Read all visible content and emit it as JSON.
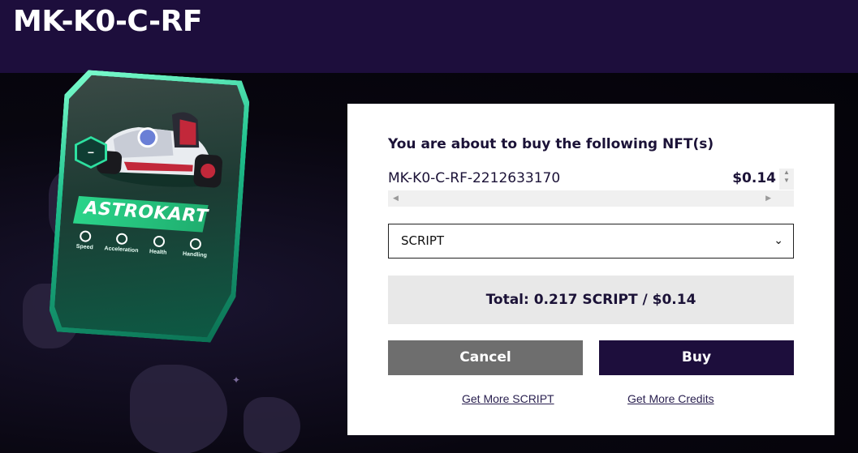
{
  "page": {
    "title": "MK-K0-C-RF"
  },
  "card": {
    "name": "ASTROKART",
    "badge": "−",
    "stats": [
      "Speed",
      "Acceleration",
      "Health",
      "Handling"
    ]
  },
  "purchase": {
    "heading": "You are about to buy the following NFT(s)",
    "item_name": "MK-K0-C-RF-2212633170",
    "item_price": "$0.14",
    "currency_select": {
      "selected": "SCRIPT"
    },
    "total": "Total: 0.217 SCRIPT / $0.14",
    "cancel_label": "Cancel",
    "buy_label": "Buy",
    "link_script": "Get More SCRIPT",
    "link_credits": "Get More Credits"
  },
  "colors": {
    "header": "#1d0e3c",
    "buy": "#1d0e3c",
    "cancel": "#6e6e6e",
    "accent": "#2ee0a0"
  }
}
